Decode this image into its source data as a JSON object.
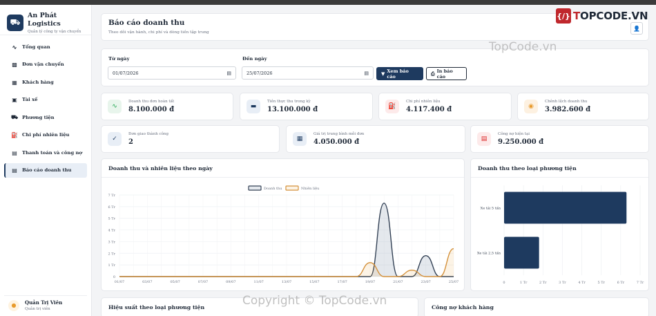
{
  "brand": {
    "name": "An Phát Logistics",
    "subtitle": "Quản lý công ty vận chuyển",
    "icon": "truck-icon"
  },
  "sidebar": {
    "items": [
      {
        "label": "Tổng quan",
        "icon": "chart-line-icon",
        "active": false
      },
      {
        "label": "Đơn vận chuyển",
        "icon": "boxes-icon",
        "active": false
      },
      {
        "label": "Khách hàng",
        "icon": "building-icon",
        "active": false
      },
      {
        "label": "Tài xế",
        "icon": "id-card-icon",
        "active": false
      },
      {
        "label": "Phương tiện",
        "icon": "truck-icon",
        "active": false
      },
      {
        "label": "Chi phí nhiên liệu",
        "icon": "gas-pump-icon",
        "active": false
      },
      {
        "label": "Thanh toán và công nợ",
        "icon": "file-invoice-icon",
        "active": false
      },
      {
        "label": "Báo cáo doanh thu",
        "icon": "chart-bar-icon",
        "active": true
      }
    ]
  },
  "user": {
    "name": "Quản Trị Viên",
    "role": "Quản trị viên"
  },
  "header": {
    "title": "Báo cáo doanh thu",
    "subtitle": "Theo dõi vận hành, chi phí và dòng tiền tập trung"
  },
  "filter": {
    "from_label": "Từ ngày",
    "from_value": "01/07/2026",
    "to_label": "Đến ngày",
    "to_value": "25/07/2026",
    "view_button": "Xem báo cáo",
    "print_button": "In báo cáo"
  },
  "stats_row1": [
    {
      "label": "Doanh thu đơn hoàn tất",
      "value": "8.100.000 đ",
      "icon": "chart-line-icon",
      "color": "#16a34a",
      "bg": "#e8f5ec"
    },
    {
      "label": "Tiền thực thu trong kỳ",
      "value": "13.100.000 đ",
      "icon": "money-bill-icon",
      "color": "#1e3a5f",
      "bg": "#e8eef6"
    },
    {
      "label": "Chi phí nhiên liệu",
      "value": "4.117.400 đ",
      "icon": "gas-pump-icon",
      "color": "#dc2626",
      "bg": "#fdeaea"
    },
    {
      "label": "Chênh lệch doanh thu",
      "value": "3.982.600 đ",
      "icon": "coins-icon",
      "color": "#e89a2b",
      "bg": "#fdf1e1"
    }
  ],
  "stats_row2": [
    {
      "label": "Đơn giao thành công",
      "value": "2",
      "icon": "check-circle-icon",
      "color": "#1e3a5f",
      "bg": "#e8eef6"
    },
    {
      "label": "Giá trị trung bình mỗi đơn",
      "value": "4.050.000 đ",
      "icon": "calculator-icon",
      "color": "#1e3a5f",
      "bg": "#e8eef6"
    },
    {
      "label": "Công nợ hiện tại",
      "value": "9.250.000 đ",
      "icon": "file-invoice-dollar-icon",
      "color": "#dc2626",
      "bg": "#fdeaea"
    }
  ],
  "panels": {
    "line_title": "Doanh thu và nhiên liệu theo ngày",
    "bar_title": "Doanh thu theo loại phương tiện",
    "perf_title": "Hiệu suất theo loại phương tiện",
    "debt_title": "Công nợ khách hàng"
  },
  "chart_data": [
    {
      "type": "area",
      "title": "Doanh thu và nhiên liệu theo ngày",
      "x": [
        "01/07",
        "02/07",
        "03/07",
        "04/07",
        "05/07",
        "06/07",
        "07/07",
        "08/07",
        "09/07",
        "10/07",
        "11/07",
        "12/07",
        "13/07",
        "14/07",
        "15/07",
        "16/07",
        "17/07",
        "18/07",
        "19/07",
        "20/07",
        "21/07",
        "22/07",
        "23/07",
        "24/07",
        "25/07"
      ],
      "x_tick_labels": [
        "01/07",
        "03/07",
        "05/07",
        "07/07",
        "09/07",
        "11/07",
        "13/07",
        "15/07",
        "17/07",
        "19/07",
        "21/07",
        "23/07",
        "25/07"
      ],
      "series": [
        {
          "name": "Doanh thu",
          "color": "#334155",
          "fill": "rgba(148,163,184,0.25)",
          "values": [
            0,
            0,
            0,
            0,
            0,
            0,
            0,
            0,
            0,
            0,
            0,
            0,
            0,
            0,
            0,
            0,
            0,
            0,
            0,
            6300000,
            0,
            0,
            1800000,
            0,
            0
          ]
        },
        {
          "name": "Nhiên liệu",
          "color": "#d4913b",
          "fill": "rgba(232,154,43,0.12)",
          "values": [
            0,
            0,
            0,
            0,
            0,
            0,
            0,
            0,
            0,
            0,
            0,
            0,
            0,
            0,
            0,
            0,
            0,
            0,
            1200000,
            0,
            0,
            550000,
            0,
            0,
            2400000
          ]
        }
      ],
      "y_ticks": [
        "0",
        "1 Tr",
        "2 Tr",
        "3 Tr",
        "4 Tr",
        "5 Tr",
        "6 Tr",
        "7 Tr"
      ],
      "ylim": [
        0,
        7000000
      ],
      "legend": "top-center",
      "grid": true
    },
    {
      "type": "bar",
      "orientation": "horizontal",
      "title": "Doanh thu theo loại phương tiện",
      "categories": [
        "Xe tải 5 tấn",
        "Xe tải 2,5 tấn"
      ],
      "values": [
        6300000,
        1800000
      ],
      "color": "#1e3a5f",
      "x_ticks": [
        "0",
        "1 Tr",
        "2 Tr",
        "3 Tr",
        "4 Tr",
        "5 Tr",
        "6 Tr",
        "7 Tr"
      ],
      "xlim": [
        0,
        7000000
      ],
      "grid": true
    }
  ],
  "watermarks": {
    "top": "TopCode.vn",
    "bottom": "Copyright © TopCode.vn",
    "logo_mark": "{/}",
    "logo_prefix": "T",
    "logo_rest": "OPCODE.VN"
  }
}
